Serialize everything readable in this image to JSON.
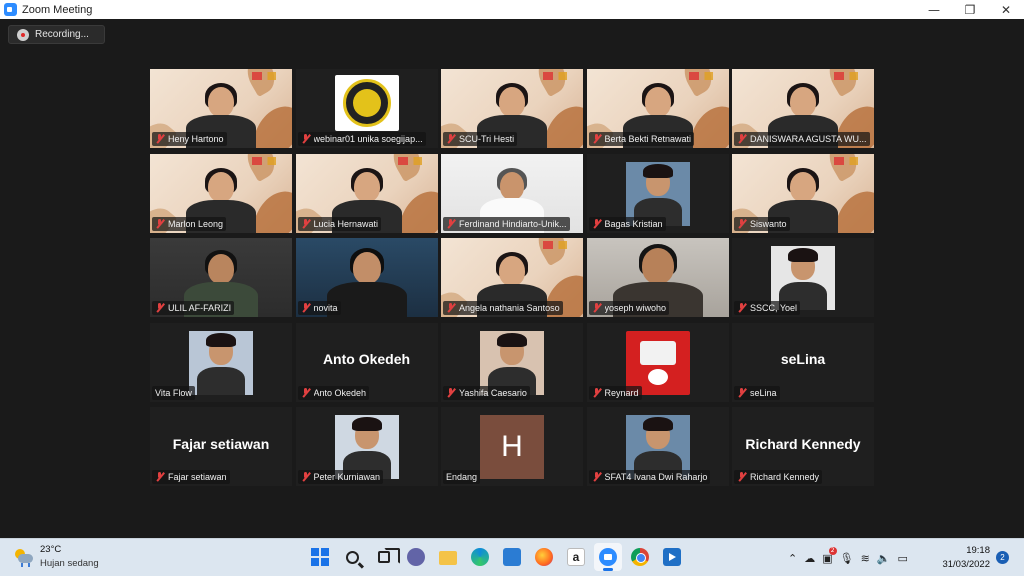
{
  "window": {
    "title": "Zoom Meeting",
    "minimize": "—",
    "maximize": "❐",
    "close": "✕"
  },
  "recording": {
    "label": "Recording..."
  },
  "participants": [
    {
      "name": "Heny Hartono",
      "muted": true,
      "video": "banner"
    },
    {
      "name": "webinar01 unika soegijap...",
      "muted": true,
      "video": "logo"
    },
    {
      "name": "SCU-Tri Hesti",
      "muted": true,
      "video": "banner"
    },
    {
      "name": "Berta Bekti Retnawati",
      "muted": true,
      "video": "banner"
    },
    {
      "name": "DANISWARA AGUSTA WU...",
      "muted": true,
      "video": "banner",
      "active_speaker": true
    },
    {
      "name": "Marlon Leong",
      "muted": true,
      "video": "banner"
    },
    {
      "name": "Lucia Hernawati",
      "muted": true,
      "video": "banner"
    },
    {
      "name": "Ferdinand Hindiarto-Unik...",
      "muted": true,
      "video": "white"
    },
    {
      "name": "Bagas Kristian",
      "muted": true,
      "video": "thumb"
    },
    {
      "name": "Siswanto",
      "muted": true,
      "video": "banner"
    },
    {
      "name": "ULIL AF-FARIZI",
      "muted": true,
      "video": "room"
    },
    {
      "name": "novita",
      "muted": true,
      "video": "blue"
    },
    {
      "name": "Angela nathania Santoso",
      "muted": true,
      "video": "banner"
    },
    {
      "name": "yoseph wiwoho",
      "muted": true,
      "video": "grey"
    },
    {
      "name": "SSCC, Yoel",
      "muted": true,
      "video": "thumb"
    },
    {
      "name": "Vita Flow",
      "muted": false,
      "video": "thumb"
    },
    {
      "name": "Anto Okedeh",
      "muted": true,
      "video": "name",
      "display_name": "Anto Okedeh"
    },
    {
      "name": "Yashifa Caesario",
      "muted": true,
      "video": "thumb"
    },
    {
      "name": "Reynard",
      "muted": true,
      "video": "poster"
    },
    {
      "name": "seLina",
      "muted": true,
      "video": "name",
      "display_name": "seLina"
    },
    {
      "name": "Fajar setiawan",
      "muted": true,
      "video": "name",
      "display_name": "Fajar setiawan"
    },
    {
      "name": "Peter Kurniawan",
      "muted": true,
      "video": "thumb"
    },
    {
      "name": "Endang",
      "muted": false,
      "video": "initial",
      "initial": "H"
    },
    {
      "name": "SFAT4 Ivana Dwi Raharjo",
      "muted": true,
      "video": "thumb"
    },
    {
      "name": "Richard Kennedy",
      "muted": true,
      "video": "name",
      "display_name": "Richard Kennedy"
    }
  ],
  "taskbar": {
    "weather": {
      "temp": "23°C",
      "condition": "Hujan sedang"
    },
    "clock": {
      "time": "19:18",
      "date": "31/03/2022"
    },
    "notifications": "2",
    "tray_badge": "2",
    "amazon_glyph": "a"
  },
  "colors": {
    "accent": "#2d8cff",
    "active_speaker_border": "#c8d64a",
    "muted_mic": "#e04040"
  }
}
